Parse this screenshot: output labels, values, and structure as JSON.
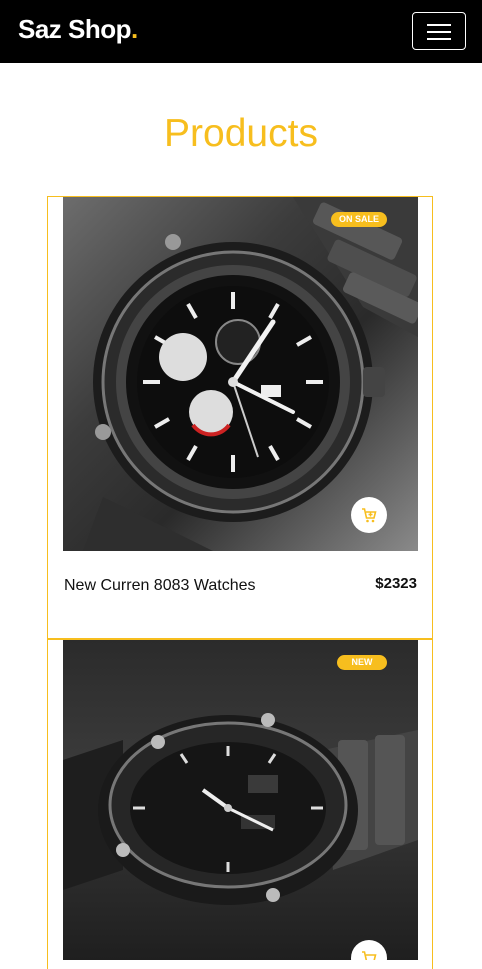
{
  "nav": {
    "brand": "Saz Shop",
    "brand_dot": "."
  },
  "page": {
    "title": "Products"
  },
  "products": [
    {
      "name": "New Curren 8083 Watches",
      "price": "$2323",
      "badge": "ON SALE"
    },
    {
      "name": "",
      "price": "",
      "badge": "NEW"
    }
  ],
  "colors": {
    "accent": "#f7be1e",
    "navbar": "#000000"
  },
  "icons": {
    "menu": "hamburger-icon",
    "cart": "add-to-cart-icon"
  }
}
